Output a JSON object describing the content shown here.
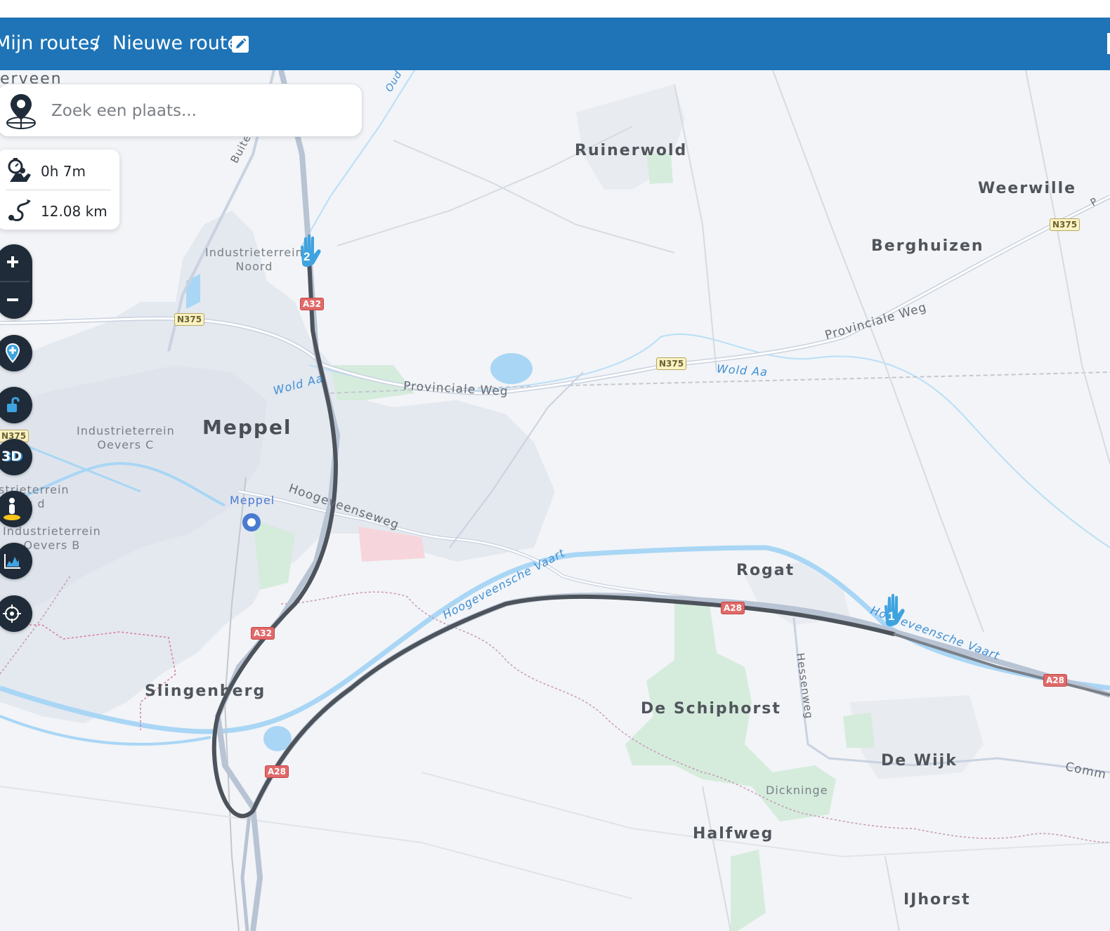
{
  "breadcrumb": {
    "first": "Mijn routes",
    "separator": "/",
    "current": "Nieuwe route",
    "edit_icon": "pencil-square-icon"
  },
  "search": {
    "placeholder": "Zoek een plaats...",
    "value": "",
    "icon": "location-pin-icon"
  },
  "route_stats": {
    "duration": "0h 7m",
    "duration_icon": "stopwatch-driver-icon",
    "distance": "12.08 km",
    "distance_icon": "route-path-icon"
  },
  "controls": {
    "zoom_in": "+",
    "zoom_out": "−",
    "add_waypoint": "pin-plus-icon",
    "lock": "lock-open-icon",
    "view_3d": "3D",
    "street_view": "pegman-icon",
    "elevation": "elevation-chart-icon",
    "locate": "crosshair-icon"
  },
  "map": {
    "places": {
      "meppel": "Meppel",
      "ruinerwold": "Ruinerwold",
      "weerwille": "Weerwille",
      "berghuizen": "Berghuizen",
      "rogat": "Rogat",
      "slingenberg": "Slingenberg",
      "de_schiphorst": "De Schiphorst",
      "de_wijk": "De Wijk",
      "halfweg": "Halfweg",
      "ijhorst": "IJhorst",
      "dicknige": "Dickninge",
      "erveen": "erveen",
      "ind_noord_1": "Industrieterrein",
      "ind_noord_2": "Noord",
      "ind_oevers_c_1": "Industrieterrein",
      "ind_oevers_c_2": "Oevers C",
      "ind_d_1": "strieterrein",
      "ind_d_2": "s d",
      "ind_oevers_b_1": "Industrieterrein",
      "ind_oevers_b_2": "Oevers B",
      "station": "Meppel"
    },
    "roads": {
      "provinciale_weg_1": "Provinciale Weg",
      "provinciale_weg_2": "Provinciale Weg",
      "hoogeveenseweg": "Hoogeveenseweg",
      "hessenweg": "Hessenweg",
      "buiten": "Buiten",
      "comm": "Comm",
      "p": "P"
    },
    "water": {
      "wold_aa_1": "Wold Aa",
      "wold_aa_2": "Wold Aa",
      "vaart_1": "Hoogeveensche Vaart",
      "vaart_2": "Hoogeveensche Vaart",
      "oud": "Oud"
    },
    "shields": {
      "n375_a": "N375",
      "n375_b": "N375",
      "n375_c": "N375",
      "n375_d": "N375",
      "a32_a": "A32",
      "a32_b": "A32",
      "a28_a": "A28",
      "a28_b": "A28",
      "a28_c": "A28"
    },
    "markers": {
      "start": "1",
      "end": "2"
    },
    "colors": {
      "header": "#1e74b7",
      "route": "#4d535b",
      "water": "#a9d6f5",
      "marker": "#3fa3e0",
      "control": "#1f2b38"
    }
  }
}
